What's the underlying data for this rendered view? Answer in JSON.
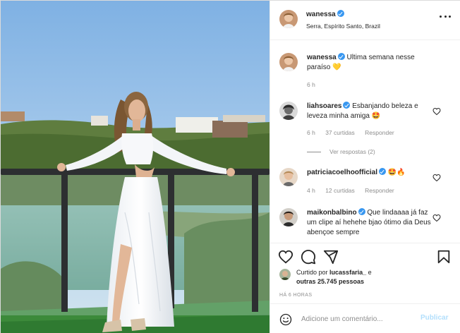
{
  "post": {
    "author": {
      "username": "wanessa",
      "verified": true,
      "location": "Serra, Espírito Santo, Brazil"
    },
    "photo": {
      "subject": "woman in white dress on glass balcony",
      "icon": "photo"
    },
    "caption": {
      "username": "wanessa",
      "text": "Ultima semana nesse paraíso 💛",
      "time": "6 h"
    },
    "comments": [
      {
        "username": "liahsoares",
        "verified": true,
        "text": "Esbanjando beleza e leveza minha amiga 🤩",
        "time": "6 h",
        "likes": "37 curtidas",
        "reply_label": "Responder",
        "view_replies": "Ver respostas (2)"
      },
      {
        "username": "patriciacoelhoofficial",
        "verified": true,
        "text": "🤩🔥",
        "time": "4 h",
        "likes": "12 curtidas",
        "reply_label": "Responder"
      },
      {
        "username": "maikonbalbino",
        "verified": true,
        "text": "Que lindaaaa já faz um clipe aí hehehe bjao ótimo dia Deus abençoe sempre"
      }
    ],
    "liked_by": {
      "prefix": "Curtido por",
      "user": "lucassfaria_",
      "conjunction": "e",
      "others": "outras 25.745 pessoas"
    },
    "timestamp": "HÁ 6 HORAS",
    "add_comment": {
      "placeholder": "Adicione um comentário...",
      "publish_label": "Publicar"
    },
    "icons": {
      "like": "heart-icon",
      "comment": "comment-icon",
      "share": "share-icon",
      "save": "bookmark-icon",
      "options": "more-options-icon",
      "emoji": "emoji-icon"
    },
    "colors": {
      "verified": "#3897f0",
      "publish_disabled": "#b2dffc",
      "secondary_text": "#8e8e8e"
    }
  }
}
